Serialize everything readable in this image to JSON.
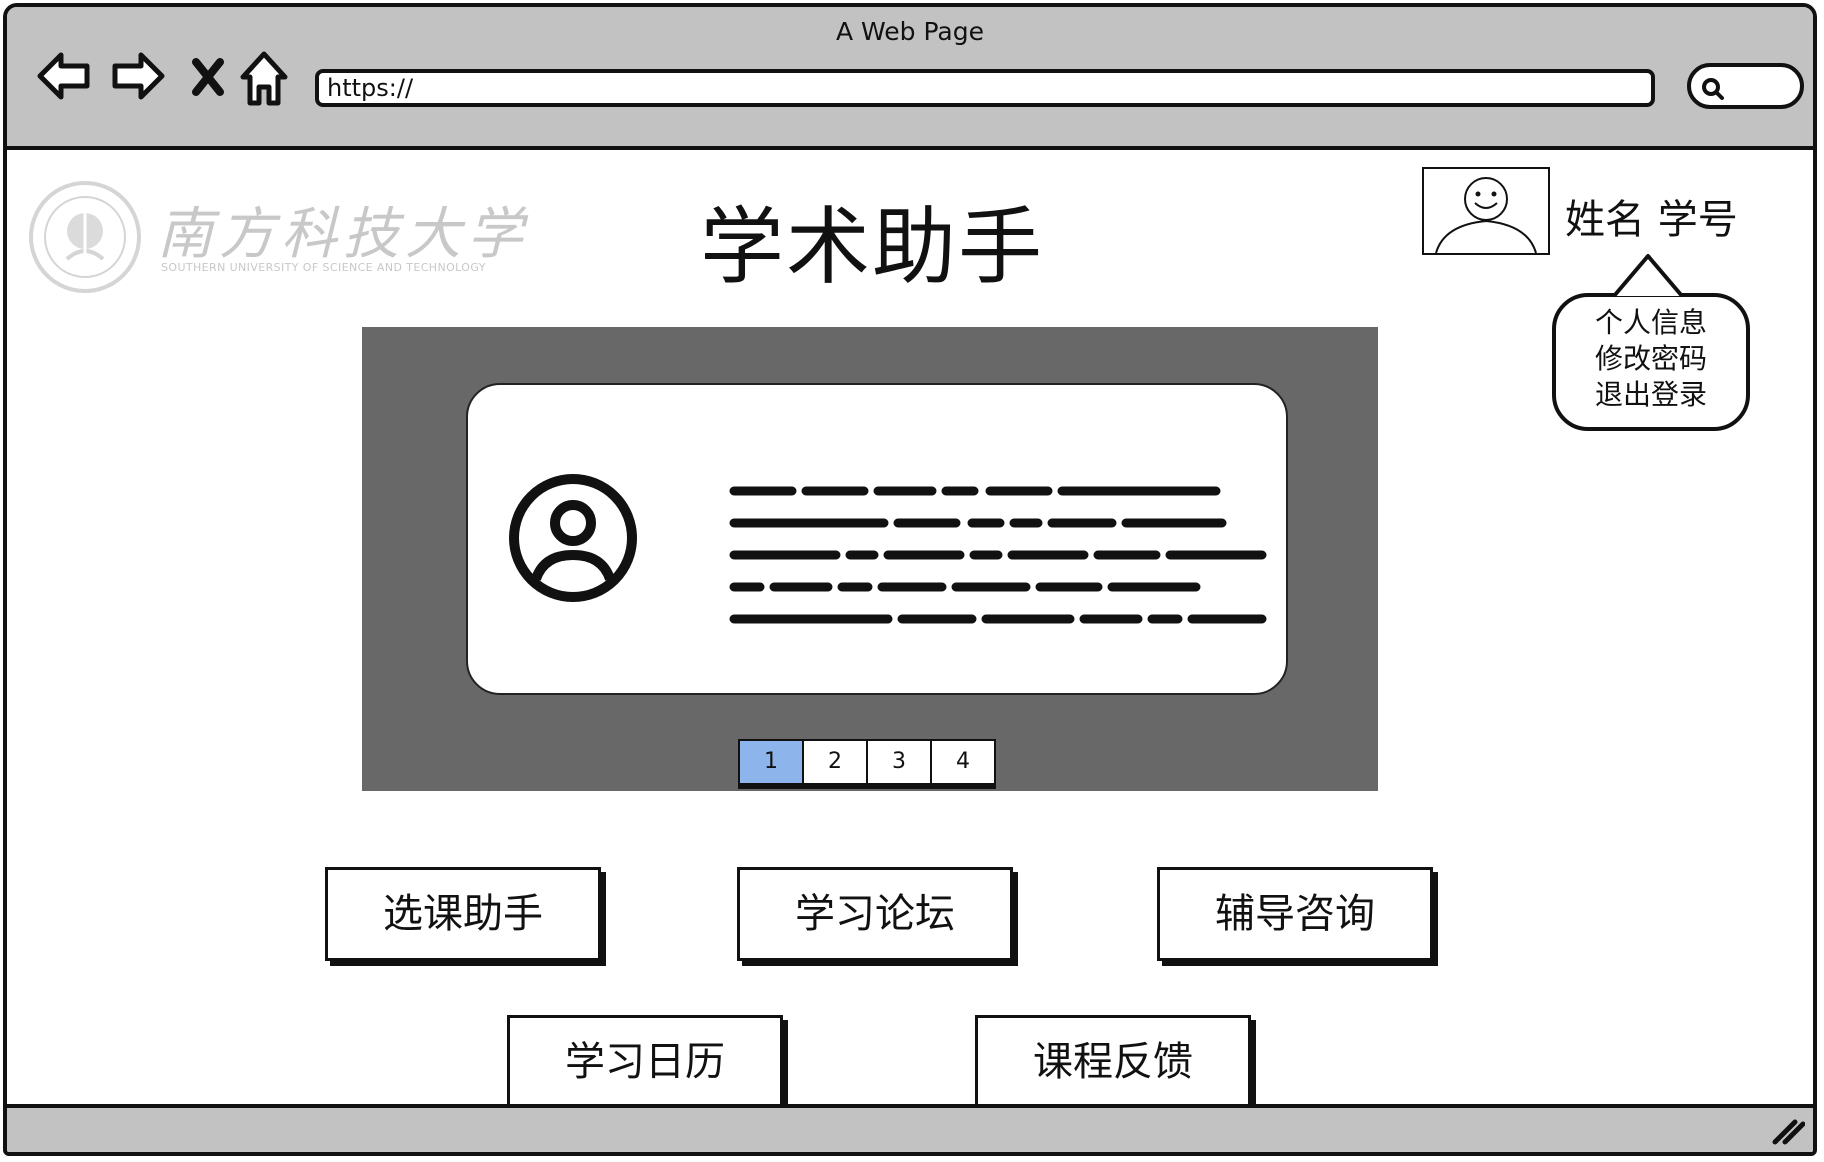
{
  "window": {
    "title": "A Web Page"
  },
  "toolbar": {
    "url": "https://",
    "icons": [
      "back-arrow-icon",
      "forward-arrow-icon",
      "close-x-icon",
      "home-icon",
      "search-icon"
    ]
  },
  "logo": {
    "name": "南方科技大学",
    "subtitle": "SOUTHERN UNIVERSITY OF SCIENCE AND TECHNOLOGY"
  },
  "header": {
    "title": "学术助手"
  },
  "user": {
    "name_label": "姓名 学号",
    "menu": [
      "个人信息",
      "修改密码",
      "退出登录"
    ]
  },
  "carousel": {
    "pages": [
      "1",
      "2",
      "3",
      "4"
    ],
    "active_page": "1",
    "active_color": "#8eb4ec",
    "background": "#686868"
  },
  "features": {
    "row1": [
      "选课助手",
      "学习论坛",
      "辅导咨询"
    ],
    "row2": [
      "学习日历",
      "课程反馈"
    ]
  }
}
